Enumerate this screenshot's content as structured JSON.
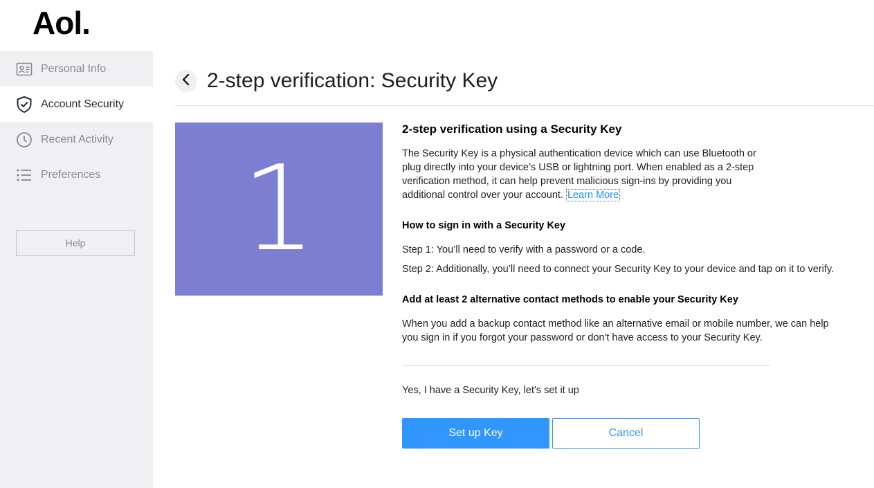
{
  "brand": {
    "logo_text": "Aol."
  },
  "sidebar": {
    "items": [
      {
        "label": "Personal Info",
        "icon": "id-card-icon",
        "active": false
      },
      {
        "label": "Account Security",
        "icon": "shield-check-icon",
        "active": true
      },
      {
        "label": "Recent Activity",
        "icon": "clock-icon",
        "active": false
      },
      {
        "label": "Preferences",
        "icon": "list-icon",
        "active": false
      }
    ],
    "help_label": "Help"
  },
  "header": {
    "back_icon": "chevron-left-icon",
    "title": "2-step verification: Security Key"
  },
  "step_panel": {
    "number": "1",
    "color": "#7c7ed2"
  },
  "content": {
    "heading": "2-step verification using a Security Key",
    "description": "The Security Key is a physical authentication device which can use Bluetooth or plug directly into your device’s USB or lightning port. When enabled as a 2-step verification method, it can help prevent malicious sign-ins by providing you additional control over your account.",
    "learn_more": "Learn More",
    "how_heading": "How to sign in with a Security Key",
    "step1": "Step 1: You’ll need to verify with a password or a code.",
    "step2": "Step 2: Additionally, you’ll need to connect your Security Key to your device and tap on it to verify.",
    "alt_heading": "Add at least 2 alternative contact methods to enable your Security Key",
    "alt_description": "When you add a backup contact method like an alternative email or mobile number, we can help you sign in if you forgot your password or don't have access to your Security Key.",
    "confirm_text": "Yes, I have a Security Key, let's set it up"
  },
  "actions": {
    "primary_label": "Set up Key",
    "secondary_label": "Cancel",
    "accent_color": "#3196ff"
  }
}
